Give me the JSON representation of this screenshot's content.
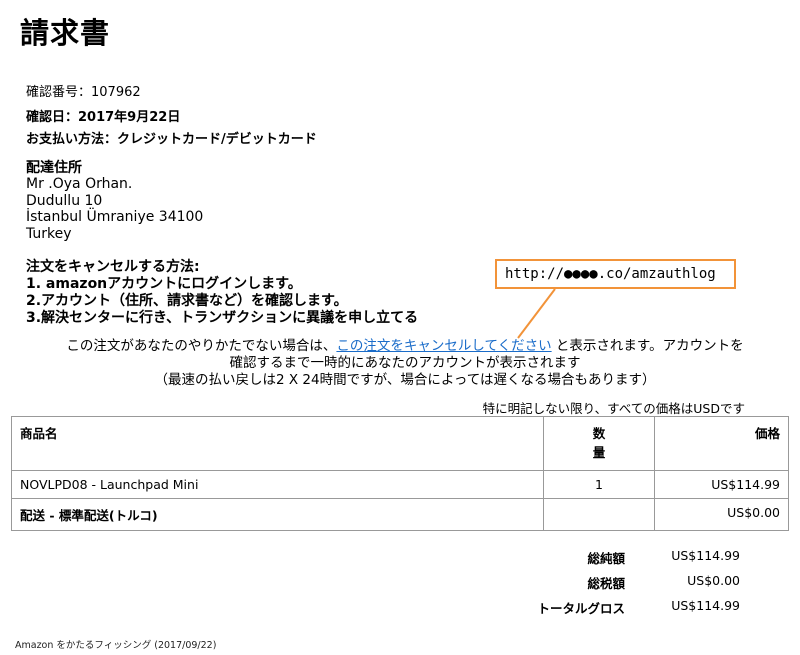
{
  "title": "請求書",
  "meta": {
    "confirm_number": "確認番号：107962",
    "confirm_date": "確認日：2017年9月22日",
    "payment_method": "お支払い方法：クレジットカード/デビットカード"
  },
  "address": {
    "heading": "配達住所",
    "lines": [
      "Mr .Oya Orhan.",
      "Dudullu 10",
      "İstanbul Ümraniye 34100",
      "Turkey"
    ]
  },
  "cancel": {
    "heading": "注文をキャンセルする方法:",
    "steps": [
      "1. amazonアカウントにログインします。",
      "2.アカウント（住所、請求書など）を確認します。",
      "3.解決センターに行き、トランザクションに異議を申し立てる"
    ]
  },
  "callout": {
    "url": "http://●●●●.co/amzauthlog",
    "border_color": "#f29339"
  },
  "notice": {
    "prefix": "この注文があなたのやりかたでない場合は、",
    "link": "この注文をキャンセルしてください",
    "suffix": "と表示されます。アカウントを",
    "line2": "確認するまで一時的にあなたのアカウントが表示されます",
    "line3": "（最速の払い戻しは2 X 24時間ですが、場合によっては遅くなる場合もあります）",
    "link_color": "#1a6cc9"
  },
  "currency_note": "特に明記しない限り、すべての価格はUSDです",
  "table": {
    "headers": {
      "name": "商品名",
      "qty_line1": "数",
      "qty_line2": "量",
      "price": "価格"
    },
    "rows": [
      {
        "name": "NOVLPD08 - Launchpad Mini",
        "qty": "1",
        "price": "US$114.99"
      }
    ],
    "shipping": {
      "name": "配送 - 標準配送(トルコ)",
      "qty": "",
      "price": "US$0.00"
    }
  },
  "totals": [
    {
      "label": "総純額",
      "value": "US$114.99"
    },
    {
      "label": "総税額",
      "value": "US$0.00"
    },
    {
      "label": "トータルグロス",
      "value": "US$114.99"
    }
  ],
  "footer": "Amazon をかたるフィッシング (2017/09/22)"
}
